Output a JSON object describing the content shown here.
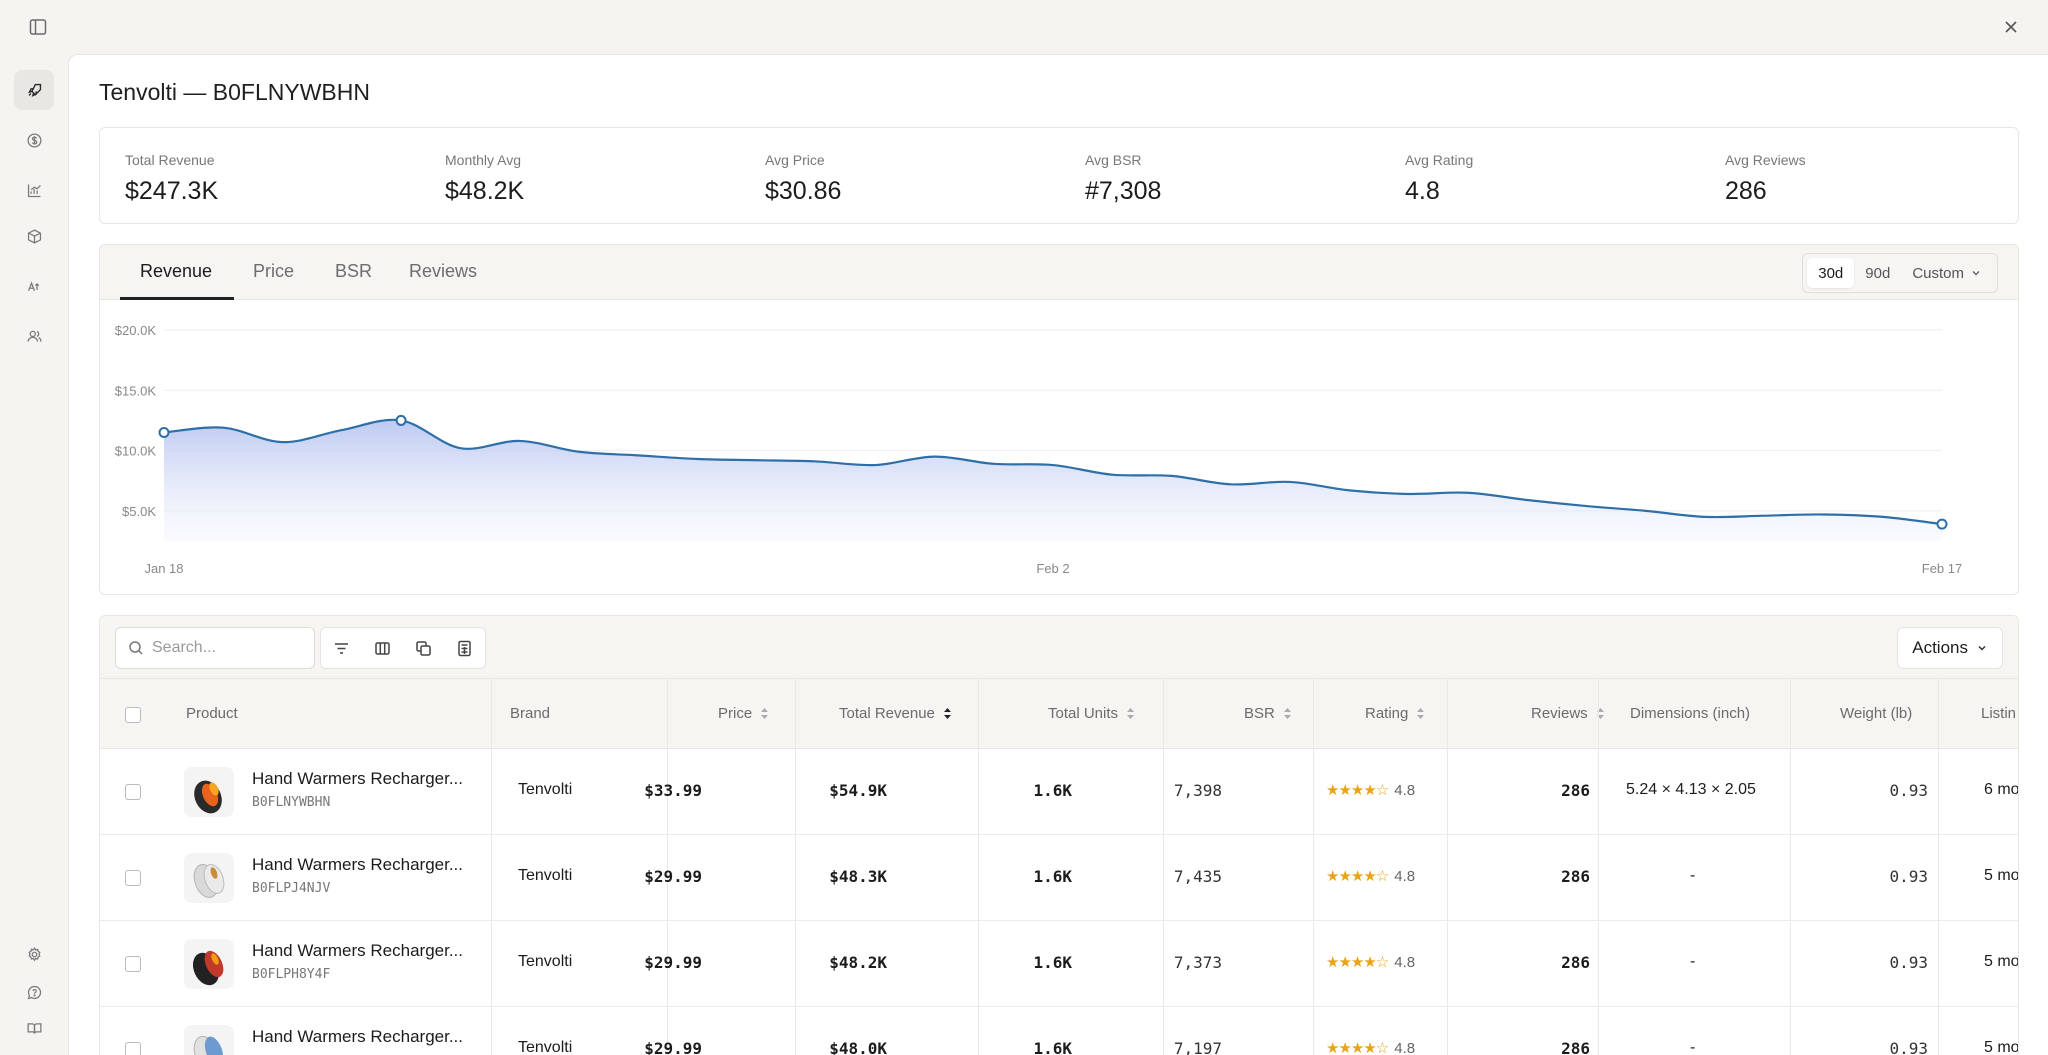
{
  "page": {
    "title": "Tenvolti — B0FLNYWBHN"
  },
  "stats": [
    {
      "label": "Total Revenue",
      "value": "$247.3K"
    },
    {
      "label": "Monthly Avg",
      "value": "$48.2K"
    },
    {
      "label": "Avg Price",
      "value": "$30.86"
    },
    {
      "label": "Avg BSR",
      "value": "#7,308"
    },
    {
      "label": "Avg Rating",
      "value": "4.8"
    },
    {
      "label": "Avg Reviews",
      "value": "286"
    }
  ],
  "chart_tabs": [
    "Revenue",
    "Price",
    "BSR",
    "Reviews"
  ],
  "chart_range": {
    "options": [
      "30d",
      "90d"
    ],
    "custom_label": "Custom",
    "selected": "30d"
  },
  "colors": {
    "line": "#2e6fa8",
    "area_top": "#c3cdf2",
    "accent_star": "#e8a317"
  },
  "chart_data": {
    "type": "area",
    "series_tab": "Revenue",
    "x": [
      "Jan 18",
      "Jan 19",
      "Jan 20",
      "Jan 21",
      "Jan 22",
      "Jan 23",
      "Jan 24",
      "Jan 25",
      "Jan 26",
      "Jan 27",
      "Jan 28",
      "Jan 29",
      "Jan 30",
      "Jan 31",
      "Feb 1",
      "Feb 2",
      "Feb 3",
      "Feb 4",
      "Feb 5",
      "Feb 6",
      "Feb 7",
      "Feb 8",
      "Feb 9",
      "Feb 10",
      "Feb 11",
      "Feb 12",
      "Feb 13",
      "Feb 14",
      "Feb 15",
      "Feb 16",
      "Feb 17"
    ],
    "values": [
      11500,
      11900,
      10700,
      11700,
      12500,
      10200,
      10800,
      9900,
      9600,
      9300,
      9200,
      9100,
      8800,
      9500,
      8900,
      8800,
      8000,
      7900,
      7200,
      7400,
      6700,
      6400,
      6500,
      5900,
      5400,
      5000,
      4500,
      4600,
      4700,
      4500,
      3900
    ],
    "ylim": [
      2500,
      20000
    ],
    "yticks": [
      {
        "v": 20000,
        "label": "$20.0K"
      },
      {
        "v": 15000,
        "label": "$15.0K"
      },
      {
        "v": 10000,
        "label": "$10.0K"
      },
      {
        "v": 5000,
        "label": "$5.0K"
      }
    ],
    "xticks": [
      {
        "i": 0,
        "label": "Jan 18"
      },
      {
        "i": 15,
        "label": "Feb 2"
      },
      {
        "i": 30,
        "label": "Feb 17"
      }
    ],
    "markers": [
      0,
      4,
      30
    ],
    "grid": true
  },
  "table": {
    "search_placeholder": "Search...",
    "actions_label": "Actions",
    "columns": {
      "product": "Product",
      "brand": "Brand",
      "price": "Price",
      "revenue": "Total Revenue",
      "units": "Total Units",
      "bsr": "BSR",
      "rating": "Rating",
      "reviews": "Reviews",
      "dimensions": "Dimensions (inch)",
      "weight": "Weight (lb)",
      "listing": "Listin"
    },
    "rows": [
      {
        "name": "Hand Warmers Recharger...",
        "asin": "B0FLNYWBHN",
        "brand": "Tenvolti",
        "price": "$33.99",
        "revenue": "$54.9K",
        "units": "1.6K",
        "bsr": "7,398",
        "stars": "★★★★☆",
        "rating": "4.8",
        "reviews": "286",
        "dimensions": "5.24 × 4.13 × 2.05",
        "weight": "0.93",
        "listing": "6 mo",
        "thumb": "orange"
      },
      {
        "name": "Hand Warmers Recharger...",
        "asin": "B0FLPJ4NJV",
        "brand": "Tenvolti",
        "price": "$29.99",
        "revenue": "$48.3K",
        "units": "1.6K",
        "bsr": "7,435",
        "stars": "★★★★☆",
        "rating": "4.8",
        "reviews": "286",
        "dimensions": "-",
        "weight": "0.93",
        "listing": "5 mo",
        "thumb": "silver"
      },
      {
        "name": "Hand Warmers Recharger...",
        "asin": "B0FLPH8Y4F",
        "brand": "Tenvolti",
        "price": "$29.99",
        "revenue": "$48.2K",
        "units": "1.6K",
        "bsr": "7,373",
        "stars": "★★★★☆",
        "rating": "4.8",
        "reviews": "286",
        "dimensions": "-",
        "weight": "0.93",
        "listing": "5 mo",
        "thumb": "red"
      },
      {
        "name": "Hand Warmers Recharger...",
        "asin": "",
        "brand": "Tenvolti",
        "price": "$29.99",
        "revenue": "$48.0K",
        "units": "1.6K",
        "bsr": "7,197",
        "stars": "★★★★☆",
        "rating": "4.8",
        "reviews": "286",
        "dimensions": "-",
        "weight": "0.93",
        "listing": "5 mo",
        "thumb": "blue"
      }
    ]
  }
}
